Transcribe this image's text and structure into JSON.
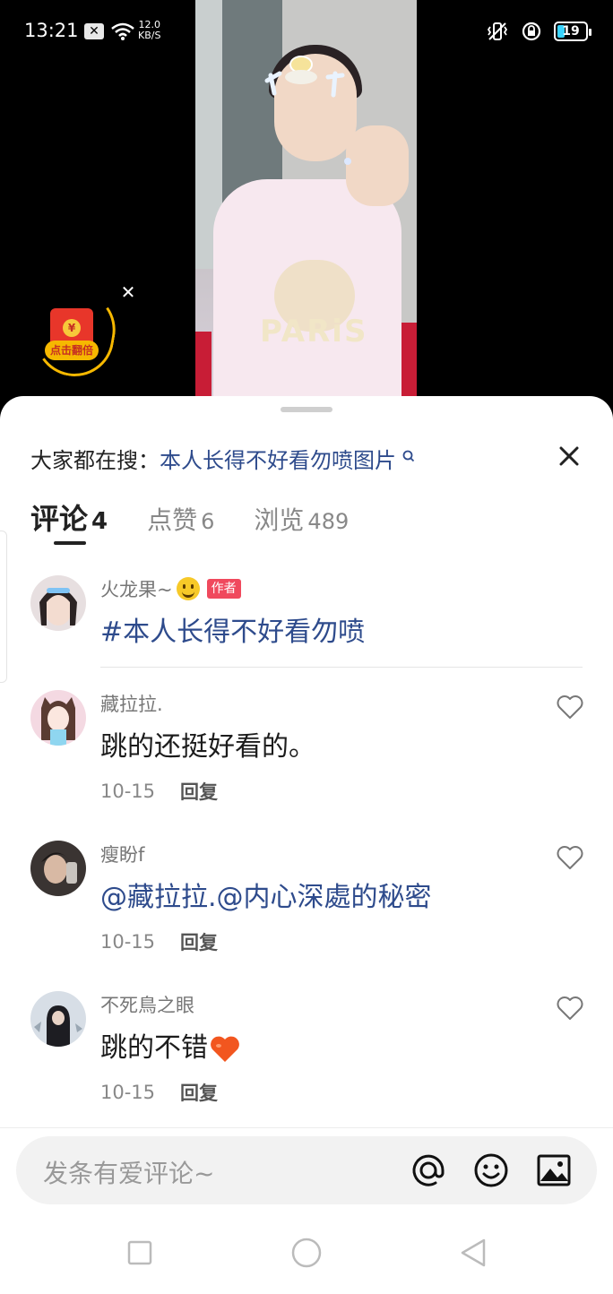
{
  "status_bar": {
    "time": "13:21",
    "speed_value": "12.0",
    "speed_unit": "KB/S",
    "battery": "19"
  },
  "video": {
    "overlay_text": "PARiS"
  },
  "red_packet": {
    "coin": "¥",
    "label": "点击翻倍"
  },
  "search": {
    "prefix": "大家都在搜：",
    "query": "本人长得不好看勿喷图片"
  },
  "tabs": [
    {
      "label": "评论",
      "count": "4",
      "active": true
    },
    {
      "label": "点赞",
      "count": "6",
      "active": false
    },
    {
      "label": "浏览",
      "count": "489",
      "active": false
    }
  ],
  "author_post": {
    "username": "火龙果~",
    "badge": "作者",
    "text": "#本人长得不好看勿喷"
  },
  "comments": [
    {
      "username": "藏拉拉.",
      "text": "跳的还挺好看的。",
      "date": "10-15",
      "reply": "回复"
    },
    {
      "username": "瘦盼f",
      "text": "@藏拉拉.@内心深處的秘密",
      "date": "10-15",
      "reply": "回复"
    },
    {
      "username": "不死鳥之眼",
      "text": "跳的不错",
      "date": "10-15",
      "reply": "回复"
    }
  ],
  "input": {
    "placeholder": "发条有爱评论~"
  },
  "icons": {
    "at": "at-icon",
    "emoji": "emoji-icon",
    "image": "image-icon",
    "heart": "heart-outline-icon"
  },
  "colors": {
    "link": "#2e4b8c",
    "badge": "#f0495d",
    "gold": "#f6b800"
  }
}
